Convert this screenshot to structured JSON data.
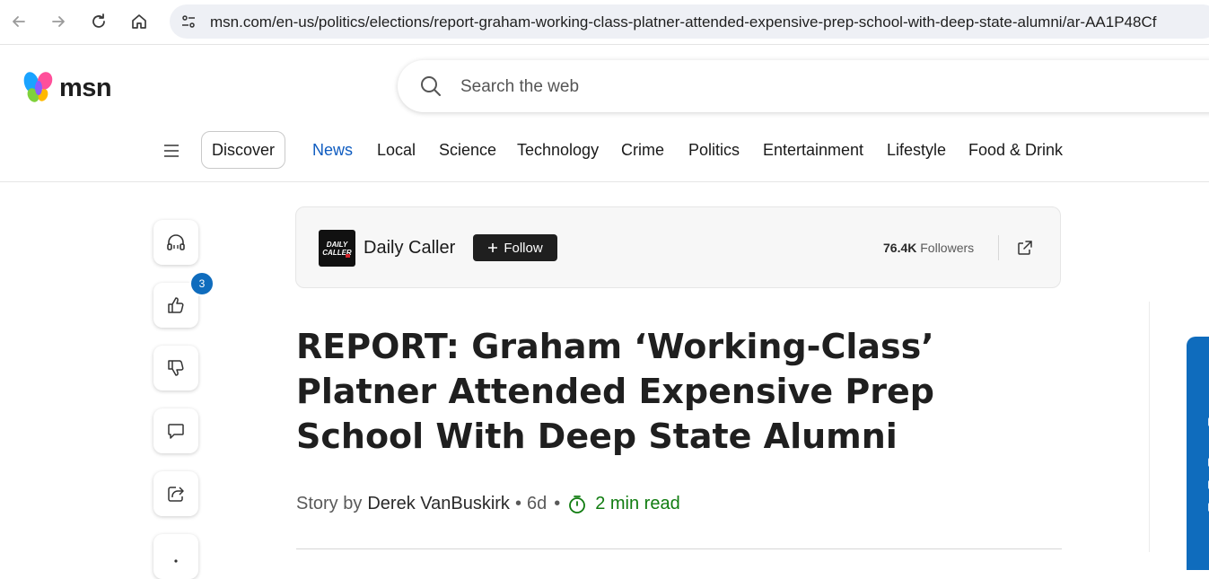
{
  "browser": {
    "url": "msn.com/en-us/politics/elections/report-graham-working-class-platner-attended-expensive-prep-school-with-deep-state-alumni/ar-AA1P48Cf"
  },
  "header": {
    "logo_text": "msn",
    "search_placeholder": "Search the web"
  },
  "nav": {
    "discover": "Discover",
    "categories": [
      "News",
      "Local",
      "Science",
      "Technology",
      "Crime",
      "Politics",
      "Entertainment",
      "Lifestyle",
      "Food & Drink"
    ],
    "active": "News"
  },
  "rail": {
    "like_count": "3"
  },
  "publisher": {
    "name": "Daily Caller",
    "logo_text_1": "DAILY",
    "logo_text_2": "CALLER",
    "follow_label": "Follow",
    "followers_count": "76.4K",
    "followers_label": "Followers"
  },
  "article": {
    "headline": "REPORT: Graham ‘Working-Class’ Platner Attended Expensive Prep School With Deep State Alumni",
    "story_by": "Story by",
    "author": "Derek VanBuskirk",
    "age": "6d",
    "read_time": "2 min read"
  },
  "colors": {
    "accent": "#0f5cc0",
    "badge": "#0f6cbd",
    "read_time": "#107c10"
  }
}
